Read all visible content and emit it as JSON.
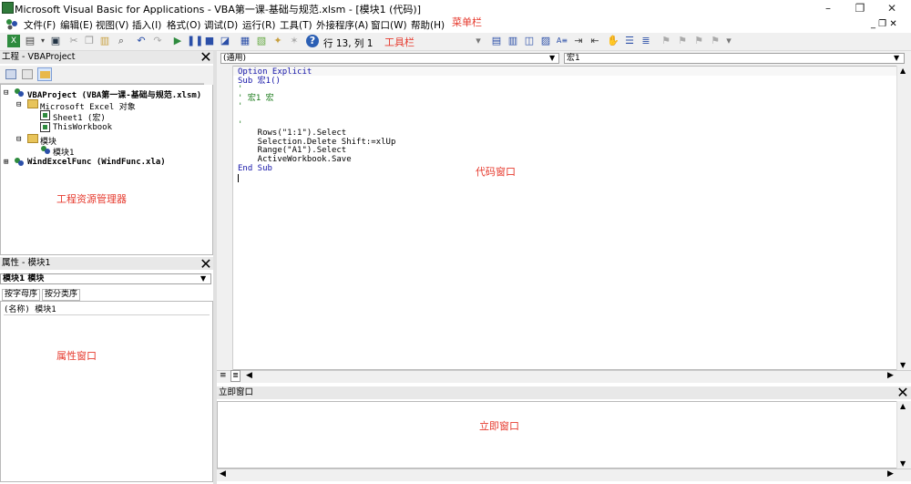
{
  "window": {
    "title": "Microsoft Visual Basic for Applications - VBA第一课-基础与规范.xlsm - [模块1 (代码)]",
    "minimize": "–",
    "restore": "❐",
    "close": "✕"
  },
  "menu": {
    "items": [
      "文件(F)",
      "编辑(E)",
      "视图(V)",
      "插入(I)",
      "格式(O)",
      "调试(D)",
      "运行(R)",
      "工具(T)",
      "外接程序(A)",
      "窗口(W)",
      "帮助(H)"
    ],
    "annotation": "菜单栏"
  },
  "toolbar": {
    "cursor_position": "行 13, 列 1",
    "annotation": "工具栏"
  },
  "project_explorer": {
    "title": "工程 - VBAProject",
    "tree": [
      "VBAProject (VBA第一课-基础与规范.xlsm)",
      "Microsoft Excel 对象",
      "Sheet1 (宏)",
      "ThisWorkbook",
      "模块",
      "模块1",
      "WindExcelFunc (WindFunc.xla)"
    ],
    "annotation": "工程资源管理器"
  },
  "properties": {
    "title": "属性 - 模块1",
    "object_selector": "模块1 模块",
    "tabs": [
      "按字母序",
      "按分类序"
    ],
    "row": "(名称) 模块1",
    "annotation": "属性窗口"
  },
  "code_window": {
    "object_combo": "(通用)",
    "proc_combo": "宏1",
    "lines": [
      "Option Explicit",
      "Sub 宏1()",
      "'",
      "' 宏1 宏",
      "'",
      "",
      "'",
      "    Rows(\"1:1\").Select",
      "    Selection.Delete Shift:=xlUp",
      "    Range(\"A1\").Select",
      "    ActiveWorkbook.Save",
      "End Sub"
    ],
    "annotation": "代码窗口"
  },
  "immediate": {
    "title": "立即窗口",
    "annotation": "立即窗口"
  },
  "colors": {
    "annotation_red": "#e63a2e",
    "keyword_blue": "#1414a8",
    "comment_green": "#1a7a1a"
  }
}
